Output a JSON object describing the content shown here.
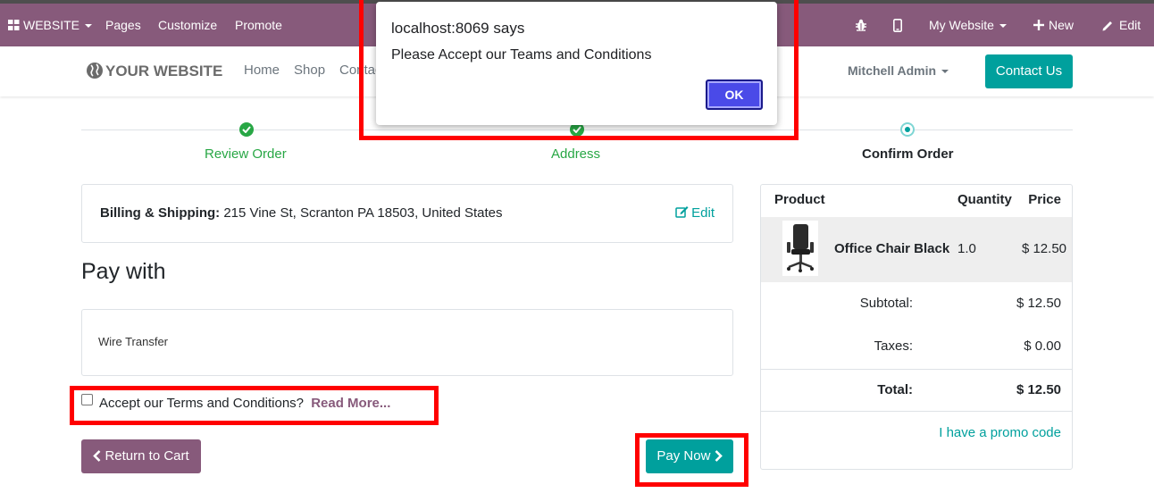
{
  "topbar": {
    "website_menu": "WEBSITE",
    "pages": "Pages",
    "customize": "Customize",
    "promote": "Promote",
    "my_website": "My Website",
    "new": "New",
    "edit": "Edit"
  },
  "header": {
    "logo": "YOUR WEBSITE",
    "nav": [
      "Home",
      "Shop",
      "Contact us"
    ],
    "user": "Mitchell Admin",
    "contact_button": "Contact Us"
  },
  "wizard": {
    "steps": [
      {
        "label": "Review Order",
        "state": "done"
      },
      {
        "label": "Address",
        "state": "done"
      },
      {
        "label": "Confirm Order",
        "state": "current"
      }
    ]
  },
  "billing": {
    "label": "Billing & Shipping:",
    "address": "215 Vine St, Scranton PA 18503, United States",
    "edit": "Edit"
  },
  "payment": {
    "heading": "Pay with",
    "method": "Wire Transfer"
  },
  "terms": {
    "text": "Accept our Terms and Conditions?",
    "read_more": "Read More...",
    "checked": false
  },
  "buttons": {
    "return": "Return to Cart",
    "pay": "Pay Now"
  },
  "summary": {
    "col_product": "Product",
    "col_quantity": "Quantity",
    "col_price": "Price",
    "product_name": "Office Chair Black",
    "product_qty": "1.0",
    "product_price": "$ 12.50",
    "subtotal_label": "Subtotal:",
    "subtotal": "$ 12.50",
    "taxes_label": "Taxes:",
    "taxes": "$ 0.00",
    "total_label": "Total:",
    "total": "$ 12.50",
    "promo": "I have a promo code"
  },
  "dialog": {
    "title": "localhost:8069 says",
    "message": "Please Accept our Teams and Conditions",
    "ok": "OK"
  },
  "colors": {
    "odoo_purple": "#875a7b",
    "teal": "#00a09d",
    "success_green": "#28a745",
    "annotation_red": "#ff0000"
  }
}
